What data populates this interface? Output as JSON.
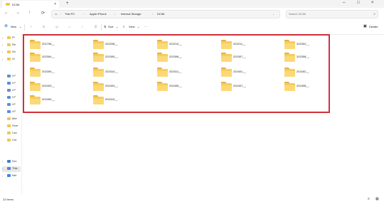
{
  "window": {
    "tab_title": "DCIM",
    "tab_close": "×",
    "new_tab": "+",
    "minimize": "–",
    "maximize": "□",
    "close": "×"
  },
  "nav": {
    "back": "←",
    "forward": "→",
    "up": "↑",
    "refresh": "⟳",
    "breadcrumb": [
      "This PC",
      "Apple iPhone",
      "Internal Storage",
      "DCIM"
    ],
    "breadcrumb_sep": "›",
    "search_placeholder": "Search DCIM"
  },
  "commandbar": {
    "new_label": "New",
    "sort_label": "Sort",
    "view_label": "View",
    "more": "···",
    "details_label": "Details"
  },
  "sidebar": {
    "items": [
      {
        "label": "Pi",
        "icon": "folder-icon",
        "chev": "›"
      },
      {
        "label": "Re",
        "icon": "folder-icon",
        "chev": "›"
      },
      {
        "label": "Sh",
        "icon": "folder-icon",
        "chev": "›"
      },
      {
        "label": "Vi",
        "icon": "folder-icon",
        "chev": "›"
      },
      {
        "label": "I:P",
        "icon": "drive-icon",
        "chev": ""
      },
      {
        "label": "I:P",
        "icon": "drive-icon",
        "chev": ""
      },
      {
        "label": "I:P",
        "icon": "drive-icon",
        "chev": ""
      },
      {
        "label": "I:P",
        "icon": "drive-icon",
        "chev": ""
      },
      {
        "label": "I:P",
        "icon": "drive-icon",
        "chev": ""
      },
      {
        "label": "I:P",
        "icon": "drive-icon",
        "chev": ""
      },
      {
        "label": "Mer",
        "icon": "folder-icon",
        "chev": ""
      },
      {
        "label": "Scre",
        "icon": "folder-icon",
        "chev": ""
      },
      {
        "label": "Lan",
        "icon": "folder-icon",
        "chev": ""
      },
      {
        "label": "Cut",
        "icon": "folder-icon",
        "chev": ""
      },
      {
        "label": "Dro",
        "icon": "cloud-icon",
        "chev": "›"
      },
      {
        "label": "This",
        "icon": "pc-icon",
        "chev": "›"
      },
      {
        "label": "Net",
        "icon": "network-icon",
        "chev": "›"
      }
    ]
  },
  "folders": [
    "201708__",
    "202208__",
    "202210__",
    "202211__",
    "202302__",
    "202304__",
    "202305__",
    "202306__",
    "202307__",
    "202308__",
    "202309__",
    "202310__",
    "202311__",
    "202401__",
    "202402__",
    "202403__",
    "202404__",
    "202406__",
    "202407__",
    "202408__",
    "202409__",
    "202410__"
  ],
  "status": {
    "item_count": "22 items",
    "view_details_icon": "≡",
    "view_tiles_icon": "▦"
  },
  "colors": {
    "highlight_border": "#d0303a",
    "folder_yellow": "#f7cd5a"
  }
}
